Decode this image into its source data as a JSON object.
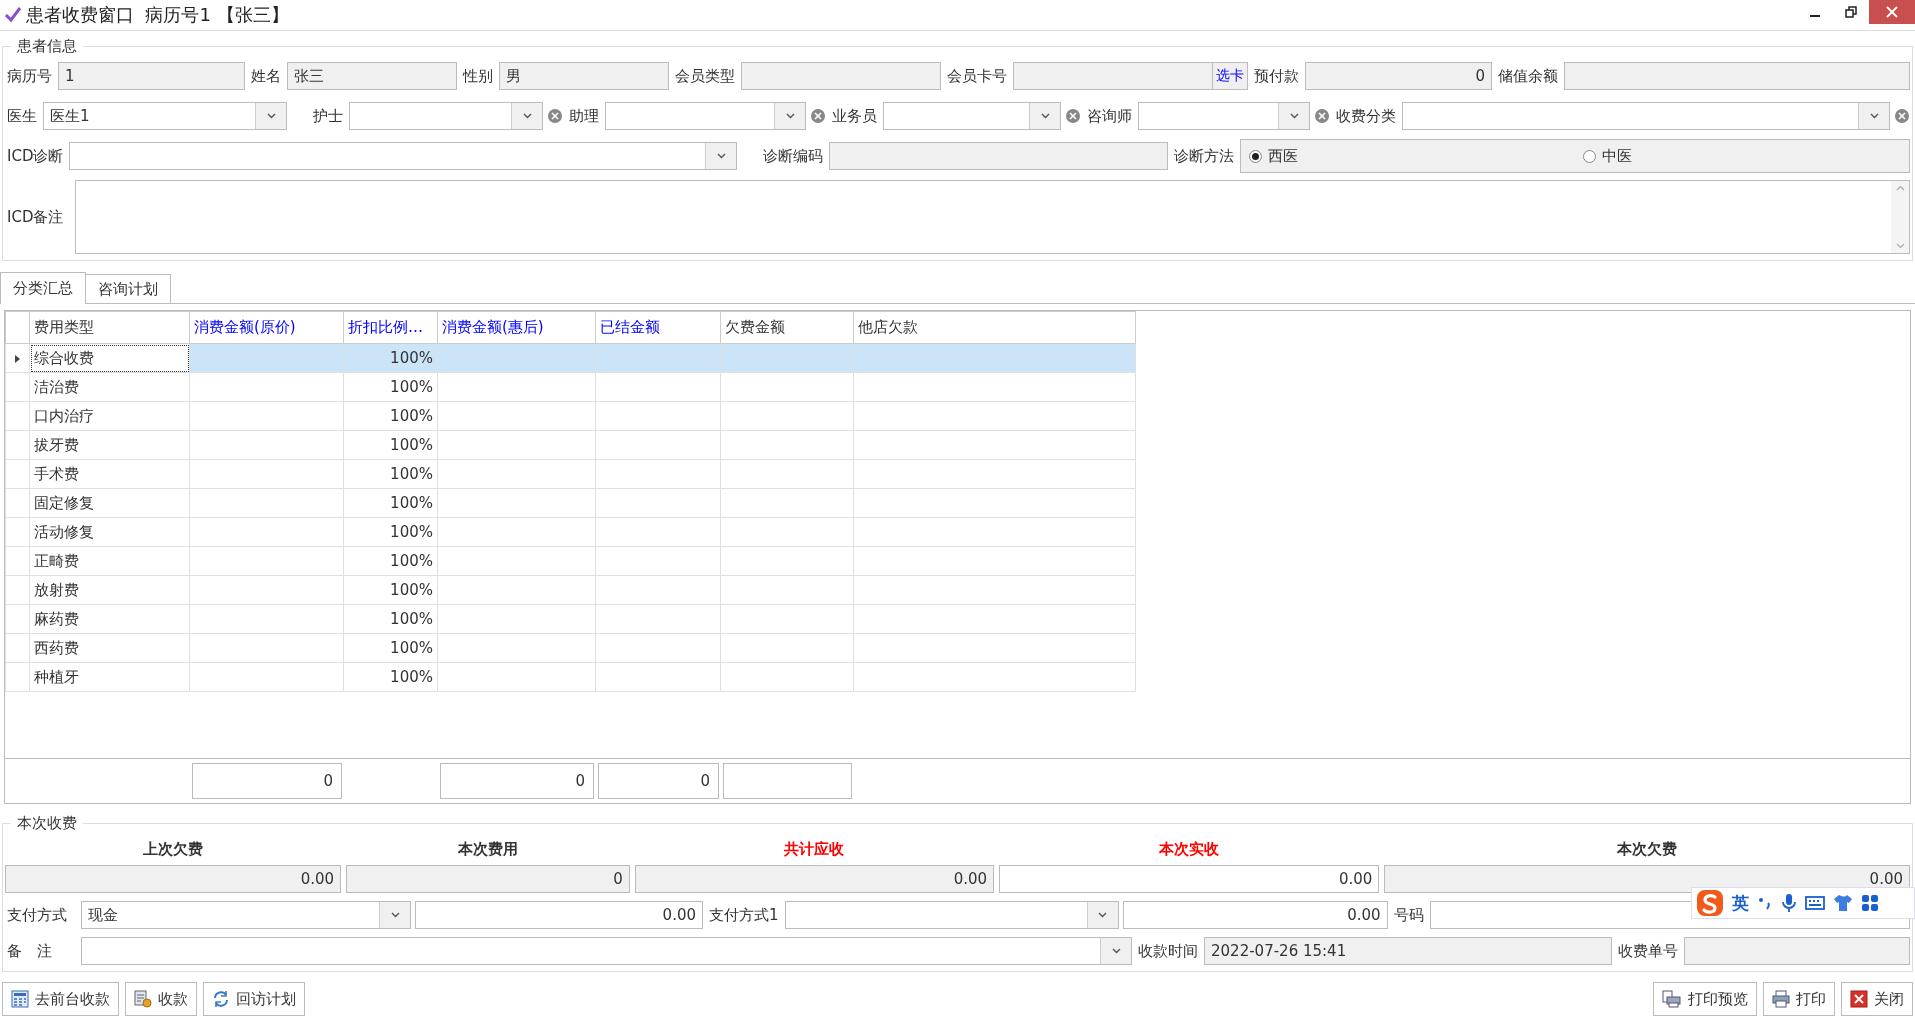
{
  "window": {
    "title": "患者收费窗口  病历号1 【张三】"
  },
  "patient_info": {
    "title": "患者信息",
    "row1": [
      {
        "label": "病历号",
        "value": "1",
        "kind": "text",
        "readonly": true
      },
      {
        "label": "姓名",
        "value": "张三",
        "kind": "text",
        "readonly": true
      },
      {
        "label": "性别",
        "value": "男",
        "kind": "text",
        "readonly": true
      },
      {
        "label": "会员类型",
        "kind": "text",
        "readonly": true
      },
      {
        "label": "会员卡号",
        "kind": "card",
        "readonly": true,
        "button": "选卡"
      },
      {
        "label": "预付款",
        "value": "0",
        "kind": "number",
        "readonly": true
      },
      {
        "label": "储值余额",
        "kind": "text",
        "readonly": true
      }
    ],
    "row2": [
      {
        "label": "医生",
        "value": "医生1",
        "kind": "combo",
        "clearable": false
      },
      {
        "label": "护士",
        "kind": "combo",
        "clearable": true
      },
      {
        "label": "助理",
        "kind": "combo",
        "clearable": true
      },
      {
        "label": "业务员",
        "kind": "combo",
        "clearable": true
      },
      {
        "label": "咨询师",
        "kind": "combo",
        "clearable": true
      },
      {
        "label": "收费分类",
        "kind": "combo",
        "clearable": true
      }
    ],
    "row3": [
      {
        "label": "ICD诊断",
        "kind": "combo",
        "clearable": false
      },
      {
        "label": "诊断编码",
        "kind": "text",
        "readonly": true
      }
    ],
    "method": {
      "label": "诊断方法",
      "options": [
        {
          "label": "西医",
          "selected": true
        },
        {
          "label": "中医",
          "selected": false
        }
      ]
    },
    "remarks": {
      "label": "ICD备注"
    }
  },
  "tabs": [
    {
      "label": "分类汇总",
      "selected": true
    },
    {
      "label": "咨询计划",
      "selected": false
    }
  ],
  "grid": {
    "columns": [
      {
        "title": "费用类型",
        "color": "#333333",
        "total_box": false
      },
      {
        "title": "消费金额(原价)",
        "color": "#0000ff",
        "total_box": true,
        "total": "0"
      },
      {
        "title": "折扣比例…",
        "color": "#0000ff",
        "total_box": false
      },
      {
        "title": "消费金额(惠后)",
        "color": "#0000ff",
        "total_box": true,
        "total": "0"
      },
      {
        "title": "已结金额",
        "color": "#0000ff",
        "total_box": true,
        "total": "0"
      },
      {
        "title": "欠费金额",
        "color": "#333333",
        "total_box": true
      },
      {
        "title": "他店欠款",
        "color": "#333333",
        "total_box": false
      }
    ],
    "rows": [
      {
        "type": "综合收费",
        "discount": "100%",
        "selected": true
      },
      {
        "type": "洁治费",
        "discount": "100%",
        "selected": false
      },
      {
        "type": "口内治疗",
        "discount": "100%",
        "selected": false
      },
      {
        "type": "拔牙费",
        "discount": "100%",
        "selected": false
      },
      {
        "type": "手术费",
        "discount": "100%",
        "selected": false
      },
      {
        "type": "固定修复",
        "discount": "100%",
        "selected": false
      },
      {
        "type": "活动修复",
        "discount": "100%",
        "selected": false
      },
      {
        "type": "正畸费",
        "discount": "100%",
        "selected": false
      },
      {
        "type": "放射费",
        "discount": "100%",
        "selected": false
      },
      {
        "type": "麻药费",
        "discount": "100%",
        "selected": false
      },
      {
        "type": "西药费",
        "discount": "100%",
        "selected": false
      },
      {
        "type": "种植牙",
        "discount": "100%",
        "selected": false
      }
    ]
  },
  "charge": {
    "title": "本次收费",
    "summary": [
      {
        "label": "上次欠费",
        "value": "0.00",
        "highlight": false,
        "readonly": true
      },
      {
        "label": "本次费用",
        "value": "0",
        "highlight": false,
        "readonly": true
      },
      {
        "label": "共计应收",
        "value": "0.00",
        "highlight": true,
        "readonly": true
      },
      {
        "label": "本次实收",
        "value": "0.00",
        "highlight": true,
        "readonly": false
      },
      {
        "label": "本次欠费",
        "value": "0.00",
        "highlight": false,
        "readonly": true
      }
    ],
    "payment": {
      "label": "支付方式",
      "value": "现金",
      "amount": "0.00"
    },
    "payment1": {
      "label": "支付方式1",
      "amount": "0.00"
    },
    "number": {
      "label": "号码"
    },
    "note": {
      "label": "备　注"
    },
    "time": {
      "label": "收款时间",
      "value": "2022-07-26 15:41"
    },
    "receipt": {
      "label": "收费单号"
    }
  },
  "left_buttons": [
    {
      "label": "去前台收款",
      "kind": "calculator"
    },
    {
      "label": "收款",
      "kind": "coins"
    },
    {
      "label": "回访计划",
      "kind": "refresh"
    }
  ],
  "right_buttons": [
    {
      "label": "打印预览",
      "kind": "preview"
    },
    {
      "label": "打印",
      "kind": "printer"
    },
    {
      "label": "关闭",
      "kind": "close"
    }
  ],
  "ime_toolbar": {
    "language": "英"
  }
}
